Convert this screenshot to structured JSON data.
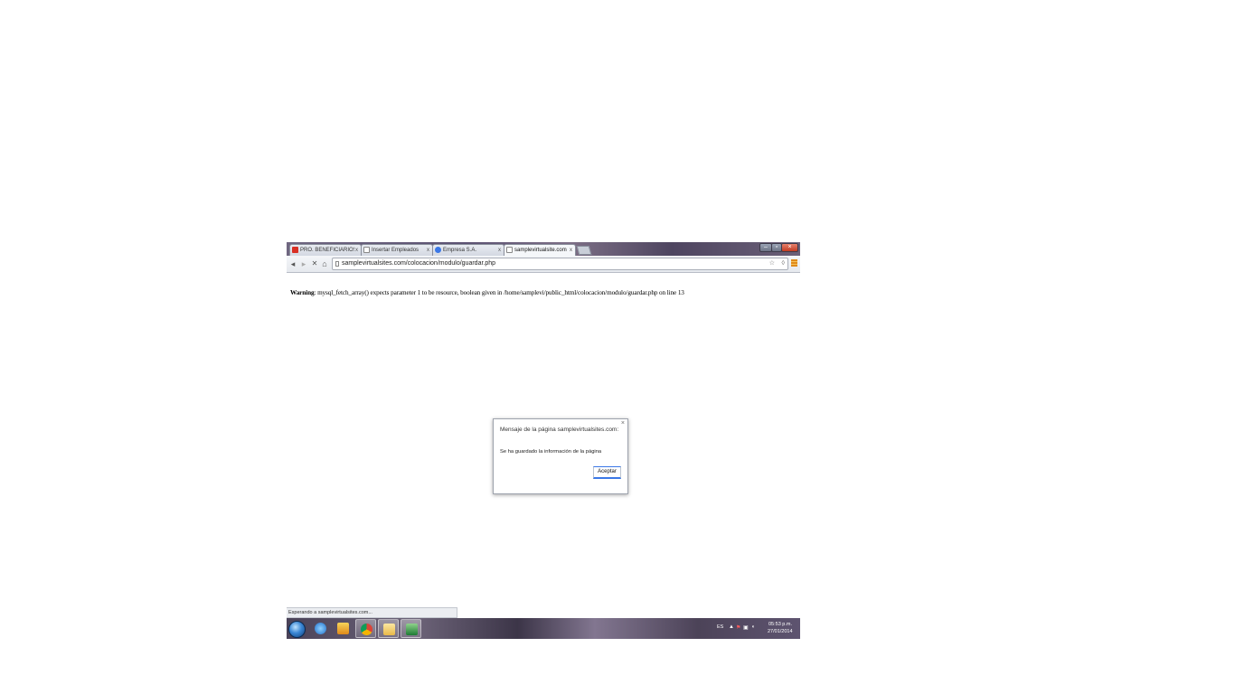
{
  "browser": {
    "tabs": [
      {
        "label": "PRO. BENEFICIARIOS",
        "favicon": "gmail-icon"
      },
      {
        "label": "Insertar Empleados",
        "favicon": "page-icon"
      },
      {
        "label": "Empresa S.A.",
        "favicon": "chrome-icon"
      },
      {
        "label": "samplevirtualsite.com",
        "favicon": "page-icon"
      }
    ],
    "tab_close_glyph": "x",
    "url": "samplevirtualsites.com/colocacion/modulo/guardar.php"
  },
  "page": {
    "warning_label": "Warning",
    "warning_text": ": mysql_fetch_array() expects parameter 1 to be resource, boolean given in /home/samplevi/public_html/colocacion/modulo/guardar.php on line 13"
  },
  "dialog": {
    "title": "Mensaje de la página samplevirtualsites.com:",
    "message": "Se ha guardado la información de la página",
    "ok_label": "Aceptar",
    "close_glyph": "×"
  },
  "statusbar": {
    "text": "Esperando a samplevirtualsites.com..."
  },
  "taskbar": {
    "language": "ES",
    "time": "05:53 p.m.",
    "date": "27/01/2014"
  },
  "colors": {
    "accent": "#3b78e7",
    "menu_icon": "#e08a1a"
  }
}
